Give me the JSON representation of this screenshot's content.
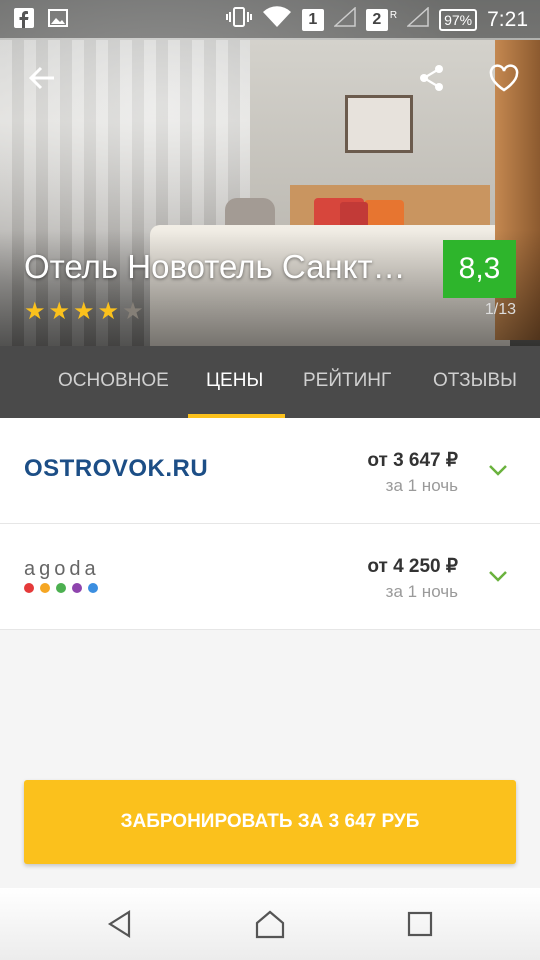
{
  "status_bar": {
    "sim1": "1",
    "sim2": "2",
    "roaming": "R",
    "battery": "97%",
    "time": "7:21"
  },
  "hotel": {
    "title": "Отель Новотель Санкт…",
    "rating": "8,3",
    "stars": 4,
    "max_stars": 5,
    "photo_counter": "1/13"
  },
  "tabs": [
    {
      "label": "ОСНОВНОЕ",
      "active": false
    },
    {
      "label": "ЦЕНЫ",
      "active": true
    },
    {
      "label": "РЕЙТИНГ",
      "active": false
    },
    {
      "label": "ОТЗЫВЫ",
      "active": false
    }
  ],
  "offers": [
    {
      "provider": "OSTROVOK.RU",
      "price": "от 3 647 ₽",
      "per": "за 1 ночь"
    },
    {
      "provider": "agoda",
      "price": "от 4 250 ₽",
      "per": "за 1 ночь"
    }
  ],
  "book_button": "ЗАБРОНИРОВАТЬ ЗА 3 647 РУБ",
  "colors": {
    "accent": "#fbc11c",
    "rating_bg": "#2eb52c",
    "tabs_bg": "#4a4a4a",
    "chevron": "#6ab23d",
    "ostrovok": "#1c4e86"
  },
  "icons": [
    "facebook-icon",
    "image-icon",
    "vibrate-icon",
    "wifi-icon",
    "signal-icon",
    "back-arrow-icon",
    "share-icon",
    "heart-icon",
    "chevron-down-icon",
    "nav-back-icon",
    "nav-home-icon",
    "nav-recents-icon"
  ]
}
